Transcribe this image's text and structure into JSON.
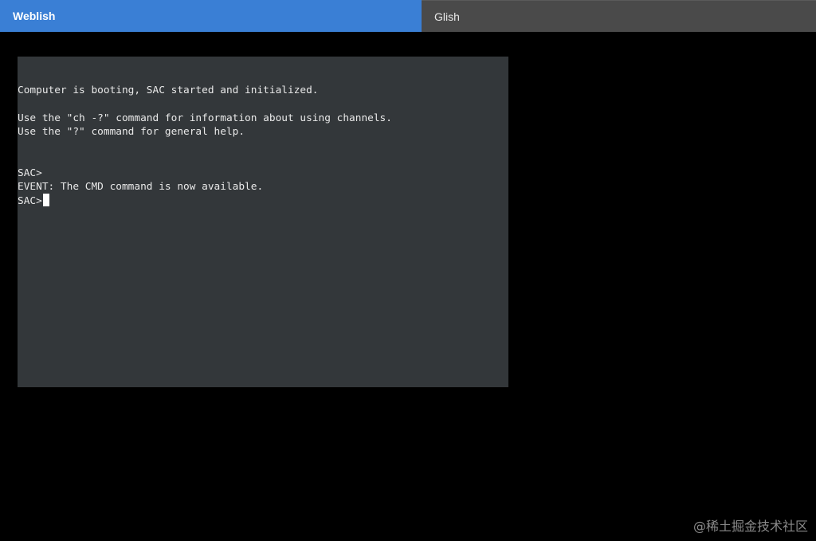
{
  "tabs": {
    "weblish_label": "Weblish",
    "glish_label": "Glish"
  },
  "console": {
    "lines": [
      "Computer is booting, SAC started and initialized.",
      "",
      "Use the \"ch -?\" command for information about using channels.",
      "Use the \"?\" command for general help.",
      "",
      "",
      "SAC>",
      "EVENT: The CMD command is now available.",
      "SAC>"
    ]
  },
  "watermark": "@稀土掘金技术社区"
}
